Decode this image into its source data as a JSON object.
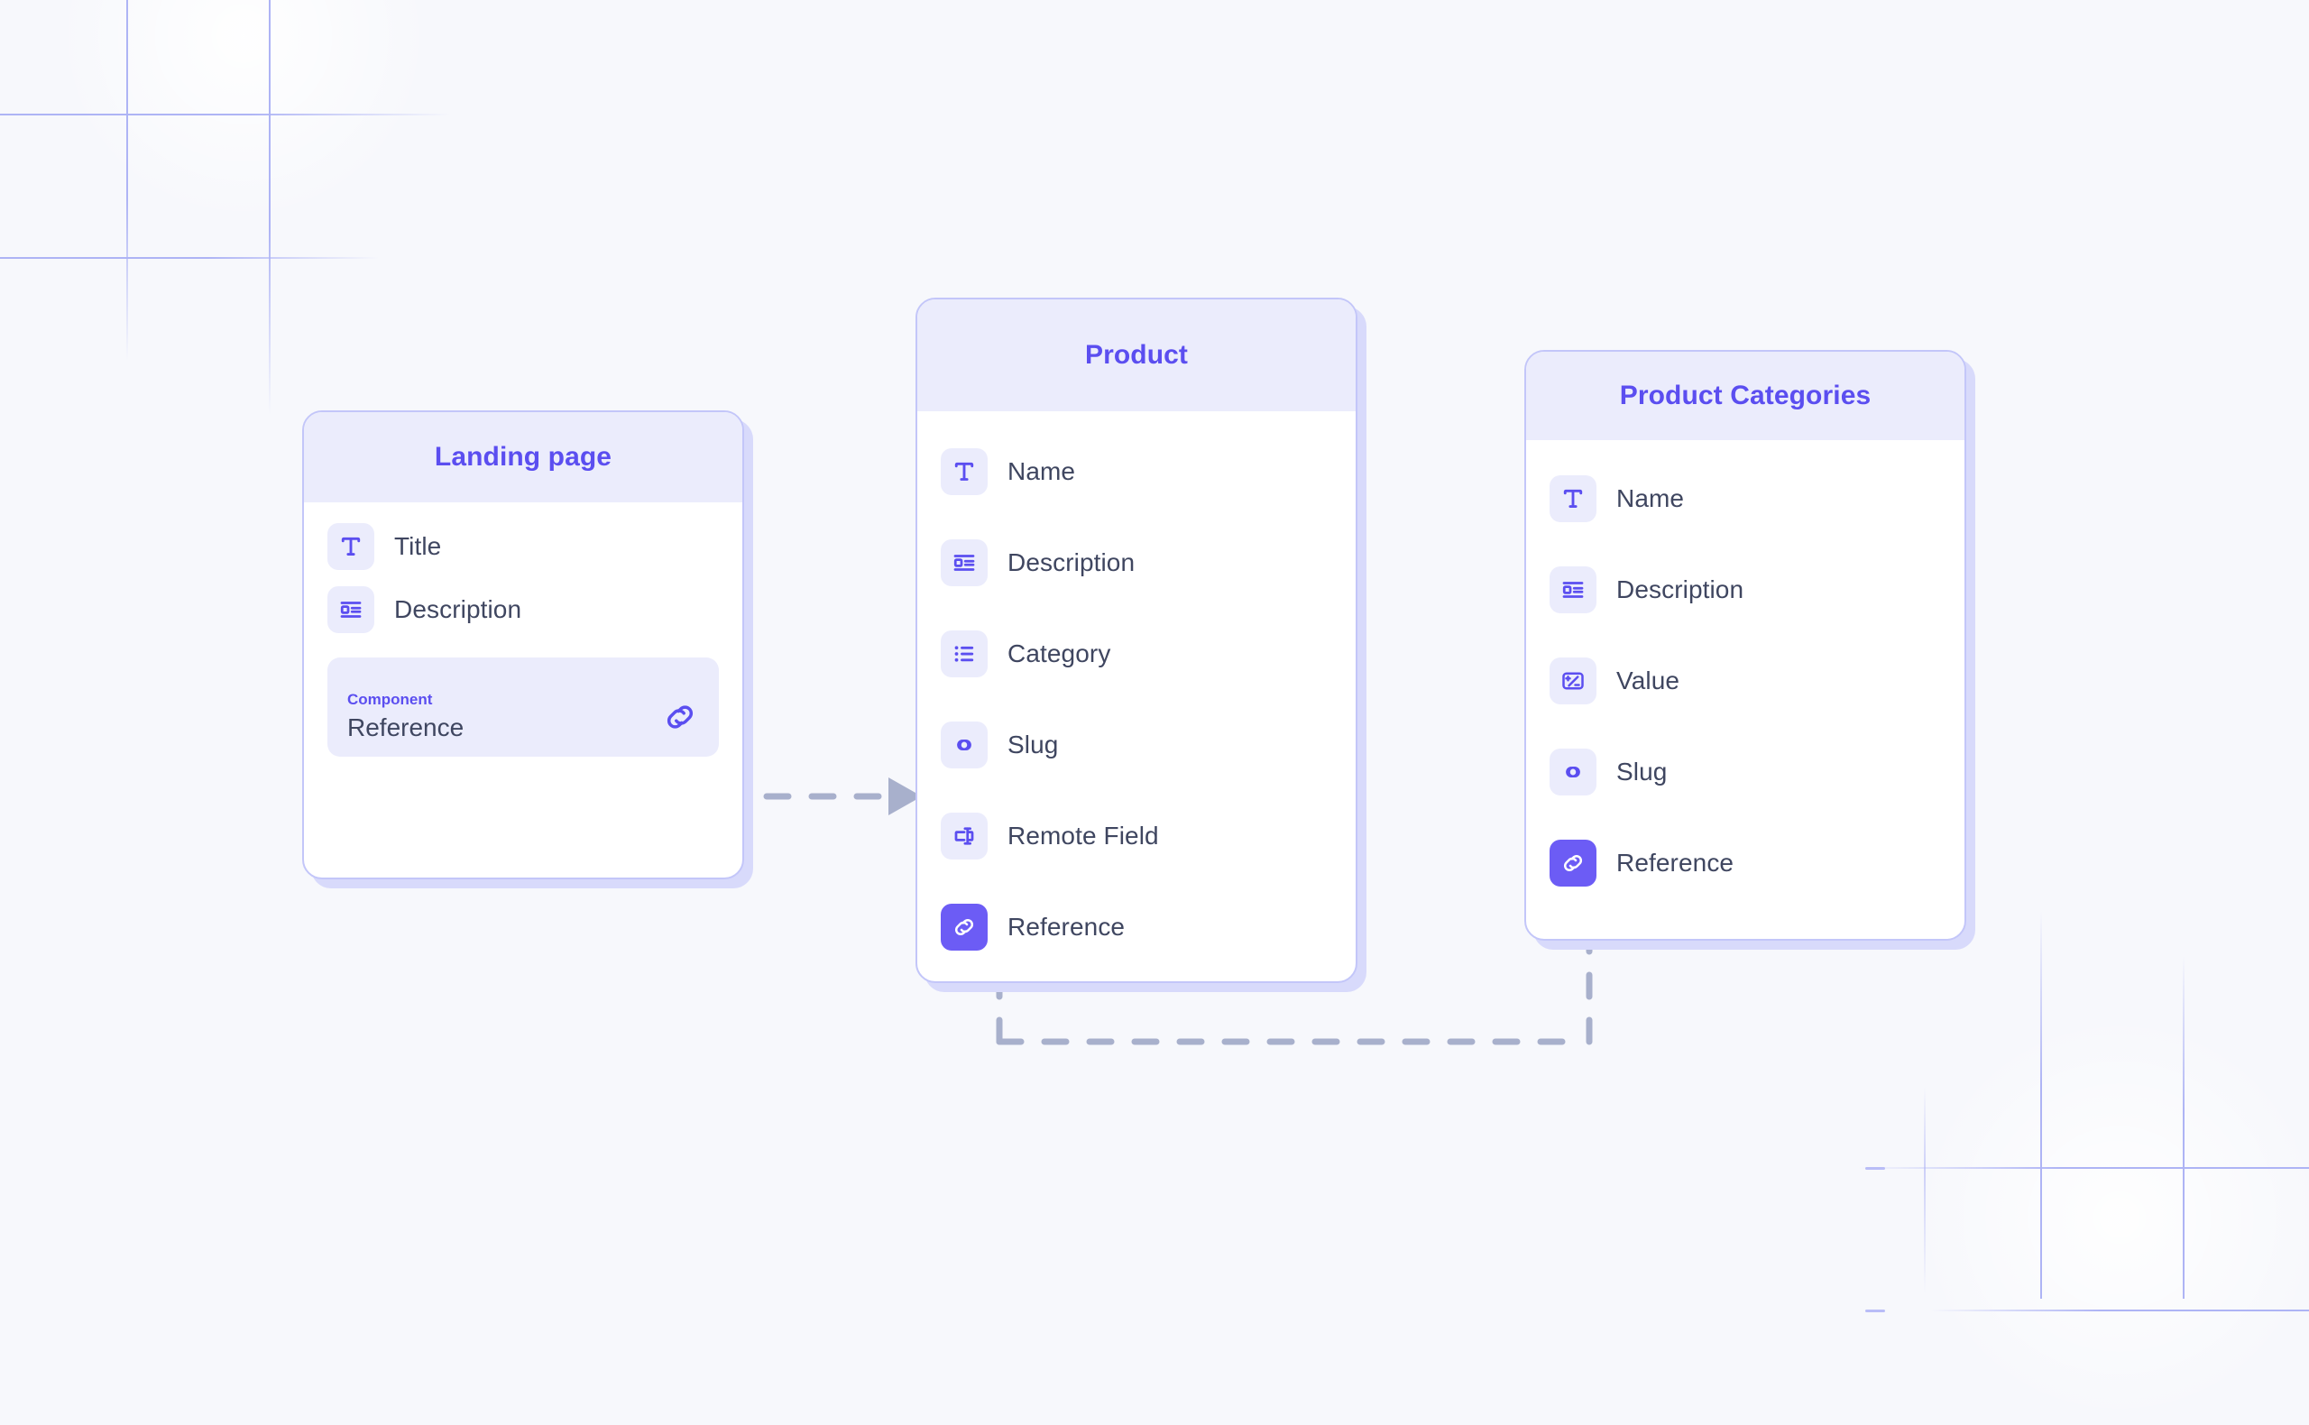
{
  "canvas": {
    "background_color": "#f7f8fc",
    "accent_color": "#5b4ef0",
    "accent_active_color": "#6c5cf5",
    "connector_color": "#a8b0cc",
    "grid_color": "#b9bdf7"
  },
  "cards": [
    {
      "id": "landing-page",
      "title": "Landing page",
      "fields": [
        {
          "label": "Title",
          "icon": "text-icon",
          "active": false
        },
        {
          "label": "Description",
          "icon": "description-icon",
          "active": false
        }
      ],
      "component": {
        "kicker": "Component",
        "value": "Reference",
        "icon": "link-icon"
      }
    },
    {
      "id": "product",
      "title": "Product",
      "fields": [
        {
          "label": "Name",
          "icon": "text-icon",
          "active": false
        },
        {
          "label": "Description",
          "icon": "description-icon",
          "active": false
        },
        {
          "label": "Category",
          "icon": "list-icon",
          "active": false
        },
        {
          "label": "Slug",
          "icon": "slug-icon",
          "active": false
        },
        {
          "label": "Remote Field",
          "icon": "remote-field-icon",
          "active": false
        },
        {
          "label": "Reference",
          "icon": "link-icon",
          "active": true
        }
      ]
    },
    {
      "id": "product-categories",
      "title": "Product Categories",
      "fields": [
        {
          "label": "Name",
          "icon": "text-icon",
          "active": false
        },
        {
          "label": "Description",
          "icon": "description-icon",
          "active": false
        },
        {
          "label": "Value",
          "icon": "value-icon",
          "active": false
        },
        {
          "label": "Slug",
          "icon": "slug-icon",
          "active": false
        },
        {
          "label": "Reference",
          "icon": "link-icon",
          "active": true
        }
      ]
    }
  ],
  "connections": [
    {
      "id": "landing-to-product",
      "from": "landing-page.component.Reference",
      "to": "product",
      "style": "dashed",
      "arrow": "end"
    },
    {
      "id": "categories-to-product",
      "from": "product-categories.Reference",
      "to": "product.Reference",
      "style": "dashed",
      "arrow": "both"
    }
  ]
}
